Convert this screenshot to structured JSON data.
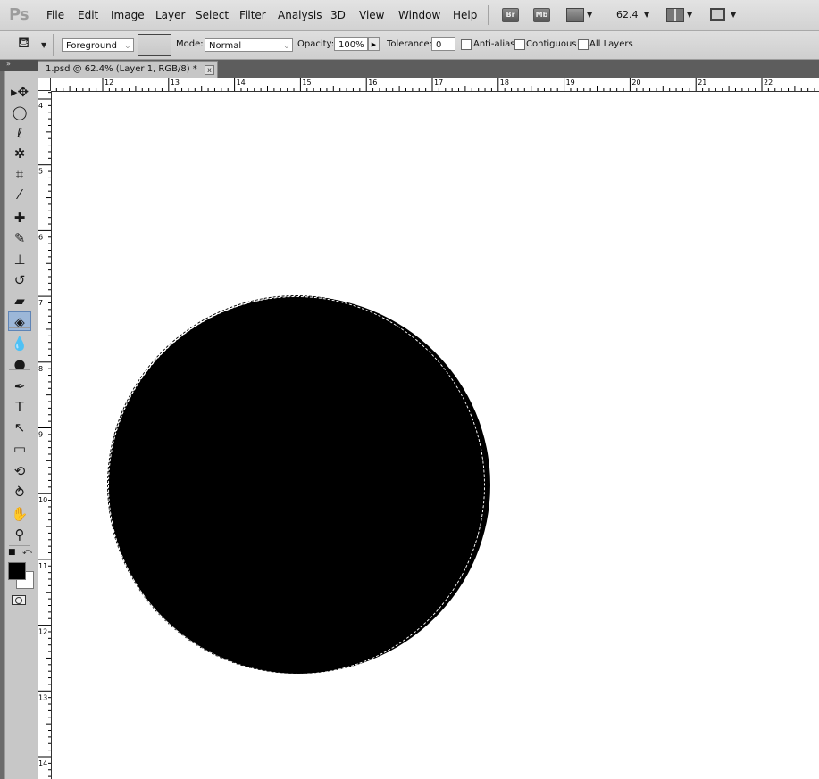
{
  "app": {
    "logo": "Ps"
  },
  "menu": [
    "File",
    "Edit",
    "Image",
    "Layer",
    "Select",
    "Filter",
    "Analysis",
    "3D",
    "View",
    "Window",
    "Help"
  ],
  "menubar_right": {
    "bridge": "Br",
    "minibridge": "Mb",
    "zoom": "62.4"
  },
  "options": {
    "fill_source": "Foreground",
    "mode_label": "Mode:",
    "mode_value": "Normal",
    "opacity_label": "Opacity:",
    "opacity_value": "100%",
    "tolerance_label": "Tolerance:",
    "tolerance_value": "0",
    "anti_alias": "Anti-alias",
    "contiguous": "Contiguous",
    "all_layers": "All Layers"
  },
  "document": {
    "tab_title": "1.psd @ 62.4% (Layer 1, RGB/8) *",
    "close": "x"
  },
  "rulers": {
    "horizontal": [
      "12",
      "13",
      "14",
      "15",
      "16",
      "17",
      "18",
      "19",
      "20",
      "21",
      "22"
    ],
    "vertical": [
      "4",
      "5",
      "6",
      "7",
      "8",
      "9",
      "10",
      "11",
      "12",
      "13",
      "14"
    ]
  },
  "tools": [
    {
      "name": "move-tool-icon",
      "glyph": "▸✥"
    },
    {
      "name": "marquee-tool-icon",
      "glyph": "◯"
    },
    {
      "name": "lasso-tool-icon",
      "glyph": "ℓ"
    },
    {
      "name": "quick-select-tool-icon",
      "glyph": "✲"
    },
    {
      "name": "crop-tool-icon",
      "glyph": "⌗"
    },
    {
      "name": "eyedropper-tool-icon",
      "glyph": "⁄"
    },
    {
      "name": "healing-brush-tool-icon",
      "glyph": "✚"
    },
    {
      "name": "brush-tool-icon",
      "glyph": "✎"
    },
    {
      "name": "clone-stamp-tool-icon",
      "glyph": "⊥"
    },
    {
      "name": "history-brush-tool-icon",
      "glyph": "↺"
    },
    {
      "name": "eraser-tool-icon",
      "glyph": "▰"
    },
    {
      "name": "paint-bucket-tool-icon",
      "glyph": "◈"
    },
    {
      "name": "blur-tool-icon",
      "glyph": "💧"
    },
    {
      "name": "dodge-tool-icon",
      "glyph": "●"
    },
    {
      "name": "pen-tool-icon",
      "glyph": "✒"
    },
    {
      "name": "type-tool-icon",
      "glyph": "T"
    },
    {
      "name": "path-select-tool-icon",
      "glyph": "↖"
    },
    {
      "name": "shape-tool-icon",
      "glyph": "▭"
    },
    {
      "name": "3d-rotate-tool-icon",
      "glyph": "⟲"
    },
    {
      "name": "3d-orbit-tool-icon",
      "glyph": "⥁"
    },
    {
      "name": "hand-tool-icon",
      "glyph": "✋"
    },
    {
      "name": "zoom-tool-icon",
      "glyph": "⚲"
    }
  ],
  "colors": {
    "foreground": "#000000",
    "background": "#ffffff",
    "active_tool": "#9cb7d8"
  }
}
